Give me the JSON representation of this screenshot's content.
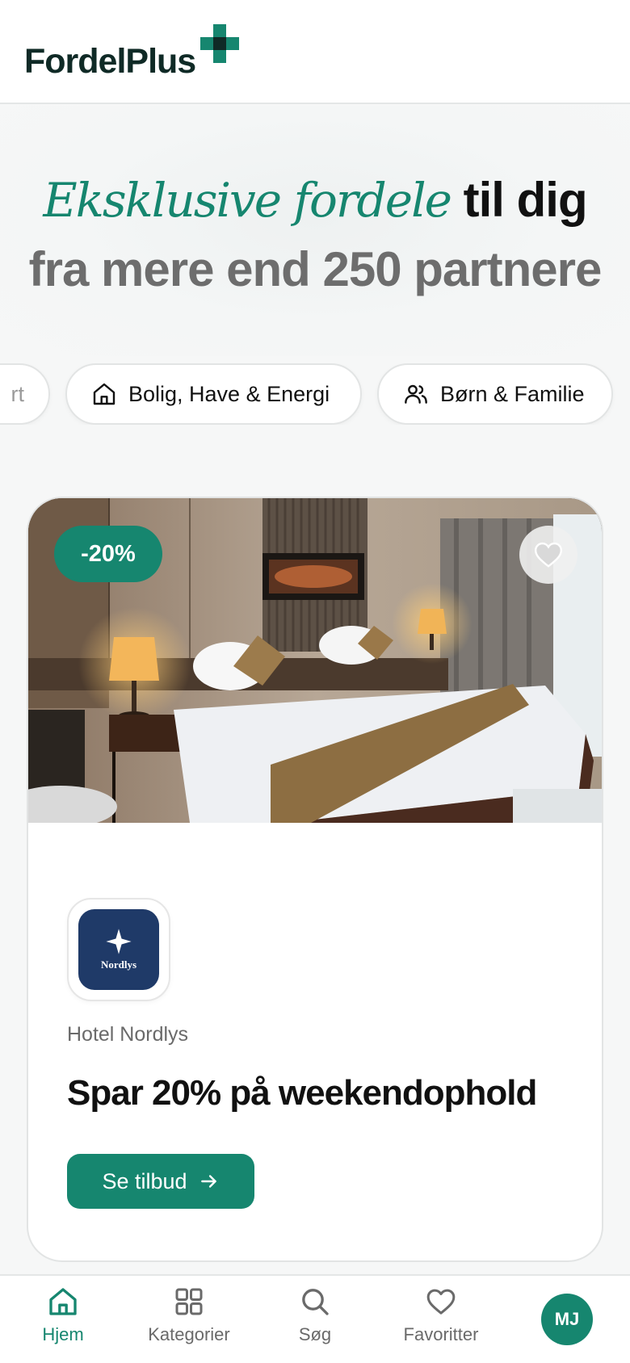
{
  "header": {
    "logo_text": "FordelPlus"
  },
  "hero": {
    "accent": "Eksklusive fordele",
    "line1_rest": " til dig",
    "line2": "fra mere end 250 partnere"
  },
  "categories": [
    {
      "label": "rt",
      "icon": "partial-chip"
    },
    {
      "label": "Bolig, Have & Energi",
      "icon": "house-icon"
    },
    {
      "label": "Børn & Familie",
      "icon": "people-icon"
    }
  ],
  "offer": {
    "discount": "-20%",
    "brand_logo_text": "Nordlys",
    "partner": "Hotel Nordlys",
    "title": "Spar 20% på weekendophold",
    "cta": "Se tilbud"
  },
  "nav": {
    "items": [
      {
        "label": "Hjem",
        "icon": "home-icon",
        "active": true
      },
      {
        "label": "Kategorier",
        "icon": "grid-icon",
        "active": false
      },
      {
        "label": "Søg",
        "icon": "search-icon",
        "active": false
      },
      {
        "label": "Favoritter",
        "icon": "heart-icon",
        "active": false
      }
    ],
    "avatar_initials": "MJ"
  },
  "colors": {
    "accent": "#16866f",
    "logo_dark": "#0f2a26",
    "brand_navy": "#1f3a68"
  }
}
